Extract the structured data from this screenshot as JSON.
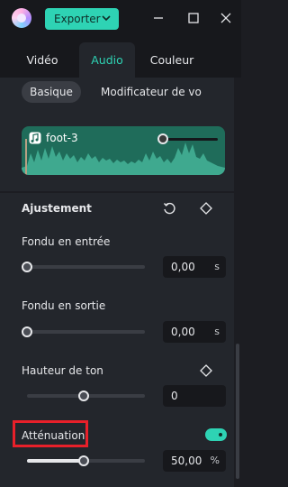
{
  "titlebar": {
    "export_label": "Exporter",
    "icons": [
      "app-logo",
      "chevron-down-icon",
      "minimize-icon",
      "maximize-icon",
      "close-icon"
    ]
  },
  "tabs": [
    {
      "label": "Vidéo",
      "active": false
    },
    {
      "label": "Audio",
      "active": true
    },
    {
      "label": "Couleur",
      "active": false
    }
  ],
  "subtabs": [
    {
      "label": "Basique",
      "active": true
    },
    {
      "label": "Modificateur de vo",
      "active": false
    }
  ],
  "clip": {
    "name": "foot-3",
    "icon": "music-note-icon",
    "volume_level": 0.1
  },
  "section": {
    "title": "Ajustement",
    "icons": [
      "reset-icon",
      "keyframe-diamond-icon"
    ]
  },
  "fade_in": {
    "label": "Fondu en entrée",
    "value": "0,00",
    "unit": "s",
    "level": 0.0
  },
  "fade_out": {
    "label": "Fondu en sortie",
    "value": "0,00",
    "unit": "s",
    "level": 0.0
  },
  "pitch": {
    "label": "Hauteur de ton",
    "value": "0",
    "level": 0.5,
    "icon": "keyframe-diamond-icon"
  },
  "ducking": {
    "label": "Atténuation",
    "value": "50,00",
    "unit": "%",
    "level": 0.5,
    "enabled": true
  },
  "colors": {
    "accent": "#2ed3b4",
    "highlight": "#e8202a",
    "panel": "#23262c",
    "wave": "#1f6c5a"
  }
}
